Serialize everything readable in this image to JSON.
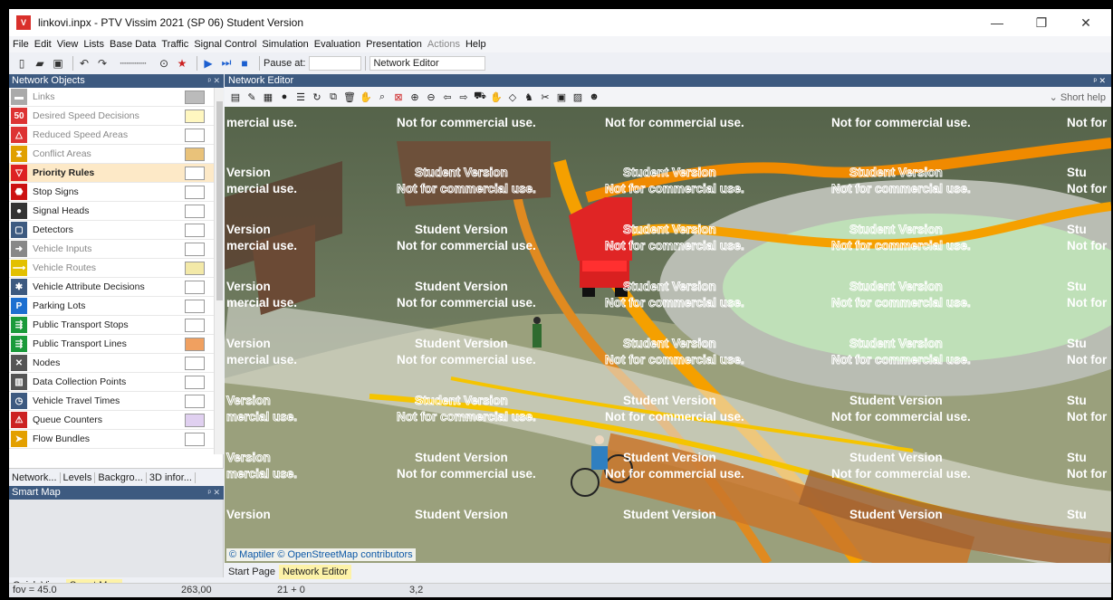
{
  "window": {
    "title": "linkovi.inpx - PTV Vissim 2021 (SP 06) Student Version",
    "app_icon": "vissim-logo-icon",
    "controls": [
      "—",
      "❐",
      "✕"
    ]
  },
  "menu": {
    "items": [
      "File",
      "Edit",
      "View",
      "Lists",
      "Base Data",
      "Traffic",
      "Signal Control",
      "Simulation",
      "Evaluation",
      "Presentation",
      "Actions",
      "Help"
    ],
    "disabled": [
      "Actions"
    ]
  },
  "toolbar": {
    "pause_label": "Pause at:",
    "pause_value": "",
    "editor_select": "Network Editor"
  },
  "network_objects": {
    "title": "Network Objects",
    "items": [
      {
        "label": "Links",
        "icon": "links-icon",
        "dim": true,
        "color": "#bbbbbb"
      },
      {
        "label": "Desired Speed Decisions",
        "icon": "speed-decision-icon",
        "dim": true,
        "color": "#fff7c0"
      },
      {
        "label": "Reduced Speed Areas",
        "icon": "reduced-speed-icon",
        "dim": true,
        "color": "#ffffff"
      },
      {
        "label": "Conflict Areas",
        "icon": "conflict-area-icon",
        "dim": true,
        "color": "#e9c27a"
      },
      {
        "label": "Priority Rules",
        "icon": "priority-rule-icon",
        "dim": false,
        "selected": true,
        "color": "#ffffff"
      },
      {
        "label": "Stop Signs",
        "icon": "stop-sign-icon",
        "dim": false,
        "color": "#ffffff"
      },
      {
        "label": "Signal Heads",
        "icon": "signal-head-icon",
        "dim": false,
        "color": "#ffffff"
      },
      {
        "label": "Detectors",
        "icon": "detector-icon",
        "dim": false,
        "color": "#ffffff"
      },
      {
        "label": "Vehicle Inputs",
        "icon": "vehicle-input-icon",
        "dim": true,
        "color": "#ffffff"
      },
      {
        "label": "Vehicle Routes",
        "icon": "vehicle-route-icon",
        "dim": true,
        "color": "#f3e9a8"
      },
      {
        "label": "Vehicle Attribute Decisions",
        "icon": "vehicle-attribute-icon",
        "dim": false,
        "color": "#ffffff"
      },
      {
        "label": "Parking Lots",
        "icon": "parking-icon",
        "dim": false,
        "color": "#ffffff"
      },
      {
        "label": "Public Transport Stops",
        "icon": "pt-stop-icon",
        "dim": false,
        "color": "#ffffff"
      },
      {
        "label": "Public Transport Lines",
        "icon": "pt-line-icon",
        "dim": false,
        "color": "#f0a060"
      },
      {
        "label": "Nodes",
        "icon": "node-icon",
        "dim": false,
        "color": "#ffffff"
      },
      {
        "label": "Data Collection Points",
        "icon": "data-collection-icon",
        "dim": false,
        "color": "#ffffff"
      },
      {
        "label": "Vehicle Travel Times",
        "icon": "travel-time-icon",
        "dim": false,
        "color": "#ffffff"
      },
      {
        "label": "Queue Counters",
        "icon": "queue-counter-icon",
        "dim": false,
        "color": "#e0d0f0"
      },
      {
        "label": "Flow Bundles",
        "icon": "flow-bundle-icon",
        "dim": false,
        "color": "#ffffff"
      }
    ],
    "tabs": [
      "Network...",
      "Levels",
      "Backgro...",
      "3D infor..."
    ]
  },
  "smart_map": {
    "title": "Smart Map",
    "tabs": [
      "Quick View",
      "Smart Map"
    ],
    "active_tab": "Smart Map"
  },
  "network_editor": {
    "title": "Network Editor",
    "short_help": "Short help",
    "credit": "© Maptiler  © OpenStreetMap contributors",
    "tabs": [
      "Start Page",
      "Network Editor"
    ],
    "active_tab": "Network Editor",
    "watermark_line1": "Student Version",
    "watermark_line2": "Not for commercial use.",
    "watermark_short1": "Version",
    "watermark_short2": "mercial use.",
    "watermark_clip1": "Stu",
    "watermark_clip2": "Not for"
  },
  "status": {
    "fov": "fov = 45.0",
    "v1": "263,00",
    "v2": "21 + 0",
    "v3": "3,2"
  },
  "colors": {
    "title_blue": "#3d5a80",
    "selected_row": "#fde9c7",
    "active_tab": "#fdf2a8"
  }
}
